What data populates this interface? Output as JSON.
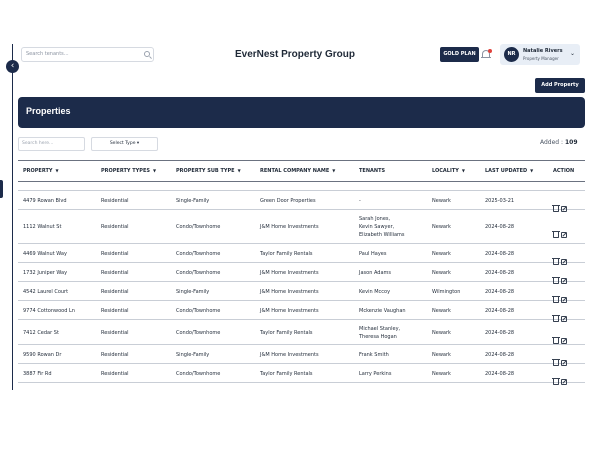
{
  "header": {
    "search_placeholder": "Search tenants...",
    "app_title": "EverNest Property Group",
    "plan_badge": "GOLD PLAN",
    "user": {
      "initials": "NR",
      "name": "Natalie Rivers",
      "role": "Property Manager"
    }
  },
  "toolbar": {
    "add_property_label": "Add Property"
  },
  "page": {
    "title": "Properties"
  },
  "filters": {
    "search_placeholder": "Search here...",
    "type_select_label": "Select Type",
    "added_label": "Added :",
    "added_count": "109"
  },
  "table": {
    "columns": [
      {
        "label": "PROPERTY",
        "sortable": true
      },
      {
        "label": "PROPERTY TYPES",
        "sortable": true
      },
      {
        "label": "PROPERTY SUB TYPE",
        "sortable": true
      },
      {
        "label": "RENTAL COMPANY NAME",
        "sortable": true
      },
      {
        "label": "TENANTS",
        "sortable": false
      },
      {
        "label": "LOCALITY",
        "sortable": true
      },
      {
        "label": "LAST UPDATED",
        "sortable": true
      },
      {
        "label": "ACTION",
        "sortable": false
      }
    ],
    "rows": [
      {
        "property": "4479 Rowan Blvd",
        "type": "Residential",
        "sub_type": "Single-Family",
        "company": "Green Door Properties",
        "tenants": [
          "-"
        ],
        "locality": "Newark",
        "updated": "2025-03-21"
      },
      {
        "property": "1112 Walnut St",
        "type": "Residential",
        "sub_type": "Condo/Townhome",
        "company": "J&M Home Investments",
        "tenants": [
          "Sarah Jones,",
          "Kevin Sawyer,",
          "Elizabeth Williams"
        ],
        "locality": "Newark",
        "updated": "2024-08-28"
      },
      {
        "property": "4469 Walnut Way",
        "type": "Residential",
        "sub_type": "Condo/Townhome",
        "company": "Taylor Family Rentals",
        "tenants": [
          "Paul Hayes"
        ],
        "locality": "Newark",
        "updated": "2024-08-28"
      },
      {
        "property": "1732 Juniper Way",
        "type": "Residential",
        "sub_type": "Condo/Townhome",
        "company": "J&M Home Investments",
        "tenants": [
          "Jason Adams"
        ],
        "locality": "Newark",
        "updated": "2024-08-28"
      },
      {
        "property": "4542 Laurel Court",
        "type": "Residential",
        "sub_type": "Single-Family",
        "company": "J&M Home Investments",
        "tenants": [
          "Kevin Mccoy"
        ],
        "locality": "Wilmington",
        "updated": "2024-08-28"
      },
      {
        "property": "9774 Cottonwood Ln",
        "type": "Residential",
        "sub_type": "Condo/Townhome",
        "company": "J&M Home Investments",
        "tenants": [
          "Mckenzie Vaughan"
        ],
        "locality": "Newark",
        "updated": "2024-08-28"
      },
      {
        "property": "7412 Cedar St",
        "type": "Residential",
        "sub_type": "Condo/Townhome",
        "company": "Taylor Family Rentals",
        "tenants": [
          "Michael Stanley,",
          "Theresa Hogan"
        ],
        "locality": "Newark",
        "updated": "2024-08-28"
      },
      {
        "property": "9590 Rowan Dr",
        "type": "Residential",
        "sub_type": "Single-Family",
        "company": "J&M Home Investments",
        "tenants": [
          "Frank Smith"
        ],
        "locality": "Newark",
        "updated": "2024-08-28"
      },
      {
        "property": "3887 Fir Rd",
        "type": "Residential",
        "sub_type": "Condo/Townhome",
        "company": "Taylor Family Rentals",
        "tenants": [
          "Larry Perkins"
        ],
        "locality": "Newark",
        "updated": "2024-08-28"
      }
    ]
  },
  "icons": {
    "collapse": "chevron-left-icon",
    "bell": "bell-icon",
    "user_menu": "chevron-down-icon",
    "search": "search-icon",
    "delete": "trash-icon",
    "edit": "edit-icon"
  },
  "colors": {
    "primary": "#1c2b4a",
    "notification": "#e0413a",
    "user_card_bg": "#e8eef6"
  }
}
